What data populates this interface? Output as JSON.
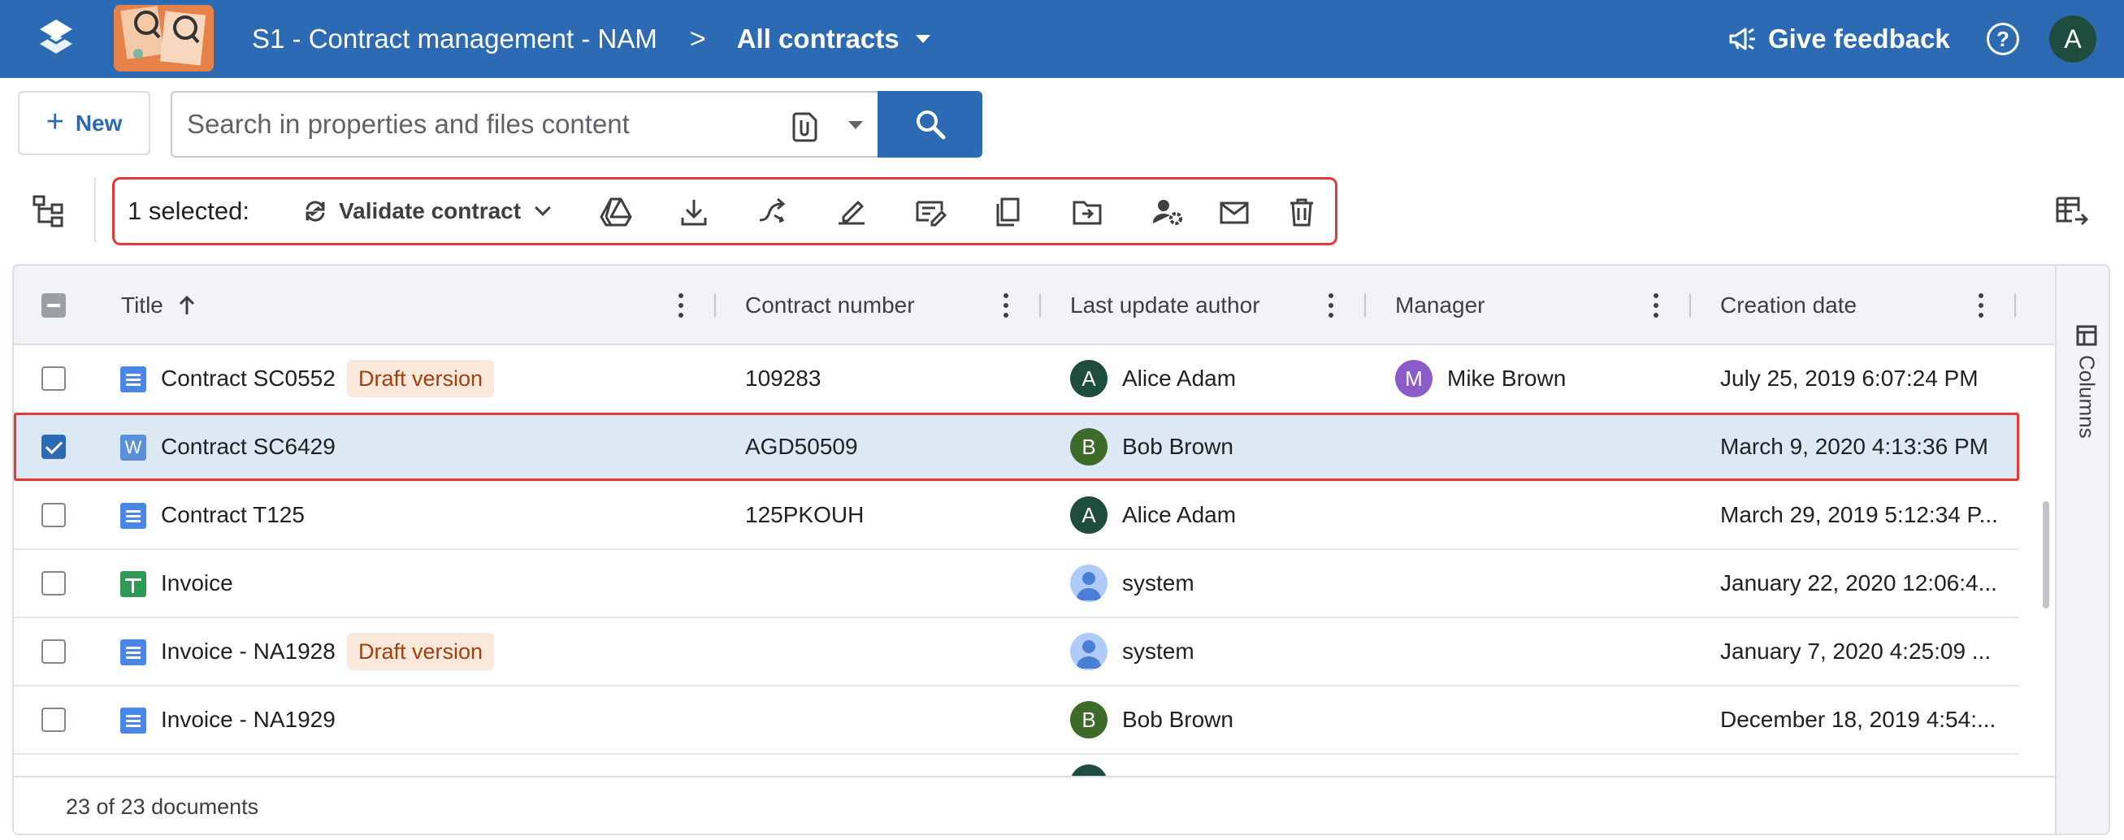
{
  "header": {
    "breadcrumb_workspace": "S1 - Contract management - NAM",
    "breadcrumb_separator": ">",
    "breadcrumb_view": "All contracts",
    "feedback_label": "Give feedback",
    "help_label": "?",
    "user_initial": "A",
    "brand_color": "#2c6bb3"
  },
  "toolbar": {
    "new_label": "New",
    "search_placeholder": "Search in properties and files content",
    "selected_label": "1 selected:",
    "action_label": "Validate contract",
    "action_icons": [
      "google-drive-icon",
      "download-icon",
      "move-icon",
      "sign-icon",
      "edit-properties-icon",
      "copy-icon",
      "move-to-folder-icon",
      "manage-access-icon",
      "email-icon",
      "delete-icon"
    ]
  },
  "grid": {
    "columns": [
      "Title",
      "Contract number",
      "Last update author",
      "Manager",
      "Creation date"
    ],
    "rows": [
      {
        "icon": "doc",
        "title": "Contract SC0552",
        "badge": "Draft version",
        "contract_number": "109283",
        "author": "Alice Adam",
        "author_initial": "A",
        "author_color": "#1e4d40",
        "manager": "Mike Brown",
        "manager_initial": "M",
        "manager_color": "#8b5cc7",
        "created": "July 25, 2019 6:07:24 PM",
        "selected": false
      },
      {
        "icon": "word",
        "icon_letter": "W",
        "title": "Contract SC6429",
        "badge": "",
        "contract_number": "AGD50509",
        "author": "Bob Brown",
        "author_initial": "B",
        "author_color": "#3d6b2a",
        "manager": "",
        "created": "March 9, 2020 4:13:36 PM",
        "selected": true
      },
      {
        "icon": "doc",
        "title": "Contract T125",
        "badge": "",
        "contract_number": "125PKOUH",
        "author": "Alice Adam",
        "author_initial": "A",
        "author_color": "#1e4d40",
        "manager": "",
        "created": "March 29, 2019 5:12:34 P...",
        "selected": false
      },
      {
        "icon": "sheet",
        "title": "Invoice",
        "badge": "",
        "contract_number": "",
        "author": "system",
        "author_initial": "",
        "author_color": "#aecbfa",
        "manager": "",
        "created": "January 22, 2020 12:06:4...",
        "selected": false
      },
      {
        "icon": "doc",
        "title": "Invoice - NA1928",
        "badge": "Draft version",
        "contract_number": "",
        "author": "system",
        "author_initial": "",
        "author_color": "#aecbfa",
        "manager": "",
        "created": "January 7, 2020 4:25:09 ...",
        "selected": false
      },
      {
        "icon": "doc",
        "title": "Invoice - NA1929",
        "badge": "",
        "contract_number": "",
        "author": "Bob Brown",
        "author_initial": "B",
        "author_color": "#3d6b2a",
        "manager": "",
        "created": "December 18, 2019 4:54:...",
        "selected": false
      }
    ],
    "columns_panel_label": "Columns",
    "footer": "23 of 23 documents"
  }
}
